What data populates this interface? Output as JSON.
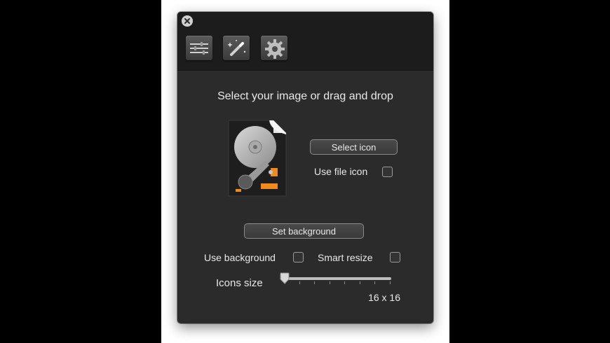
{
  "toolbar": {
    "tabs": [
      {
        "icon": "sliders-icon"
      },
      {
        "icon": "magic-wand-icon"
      },
      {
        "icon": "gear-icon"
      }
    ]
  },
  "main": {
    "headline": "Select your image or drag and drop",
    "select_icon_label": "Select icon",
    "use_file_icon_label": "Use file icon",
    "set_background_label": "Set background",
    "use_background_label": "Use background",
    "smart_resize_label": "Smart resize",
    "icons_size_label": "Icons size",
    "icons_size_value": "16 x 16",
    "icons_size_slider_fraction": 0.0,
    "preview_icon": "hard-drive-document-icon"
  },
  "colors": {
    "window_bg": "#2b2b2b",
    "titlebar_bg": "#1c1c1c",
    "text": "#e8e8e8",
    "accent_orange": "#f08a1c"
  }
}
